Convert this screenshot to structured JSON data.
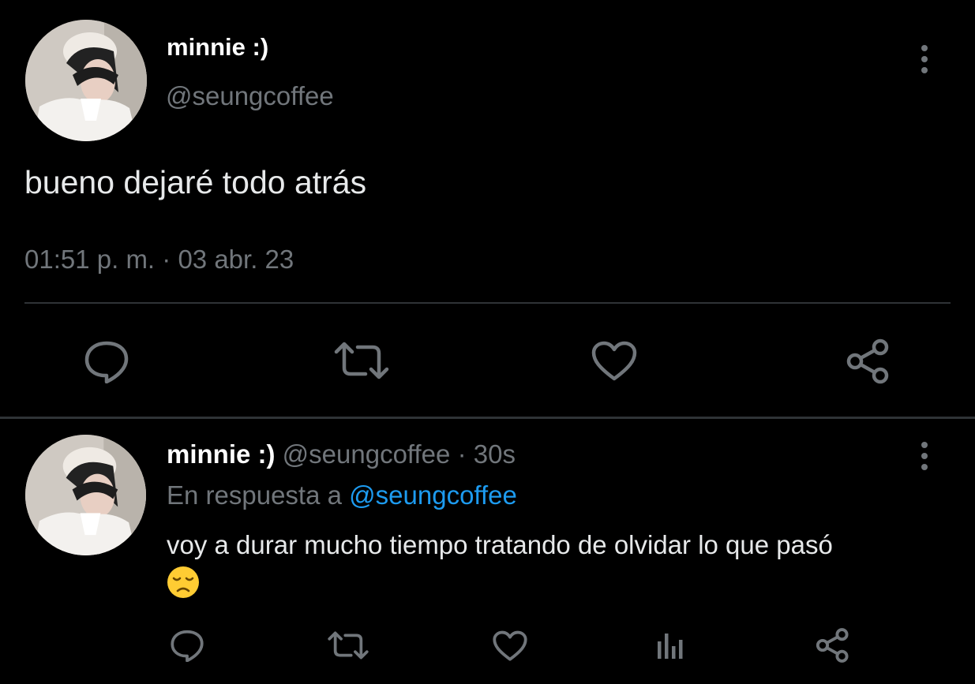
{
  "main_tweet": {
    "display_name": "minnie :)",
    "handle": "@seungcoffee",
    "text": "bueno dejaré todo atrás",
    "time": "01:51 p. m.",
    "separator": "·",
    "date": "03 abr. 23",
    "avatar_icon": "profile-photo",
    "more_icon": "vertical-ellipsis-icon"
  },
  "actions": {
    "reply_icon": "reply-icon",
    "retweet_icon": "retweet-icon",
    "like_icon": "heart-icon",
    "share_icon": "share-icon",
    "views_icon": "views-bar-chart-icon"
  },
  "reply_tweet": {
    "display_name": "minnie :)",
    "handle": "@seungcoffee",
    "separator": "·",
    "time_ago": "30s",
    "reply_prefix": "En respuesta a",
    "reply_to": "@seungcoffee",
    "text": "voy a durar mucho tiempo tratando de olvidar lo que pasó",
    "emoji": "😞"
  },
  "colors": {
    "background": "#000000",
    "muted": "#71767b",
    "link": "#1d9bf0",
    "divider": "#2f3336"
  }
}
